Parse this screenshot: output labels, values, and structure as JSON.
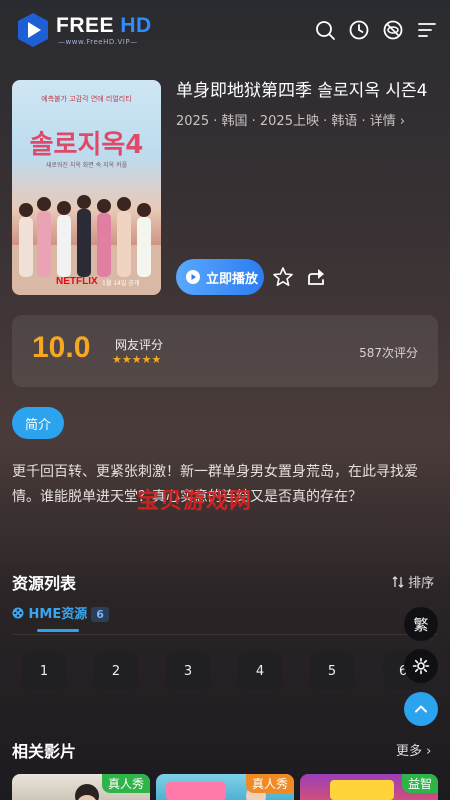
{
  "header": {
    "logo_main": "FREE ",
    "logo_hd": "HD",
    "logo_sub": "—www.FreeHD.VIP—",
    "icons": [
      "search-icon",
      "history-icon",
      "no-ads-icon",
      "menu-icon"
    ]
  },
  "poster": {
    "top_text": "예측불가 고감각 연애 리얼리티",
    "title_text": "솔로지옥4",
    "sub_text": "새로워진 지옥 화면 속 지옥 커플",
    "brand": "NETFLIX",
    "date_text": "1월 14일 공개"
  },
  "movie": {
    "title": "单身即地狱第四季 솔로지옥 시즌4",
    "meta": "2025 · 韩国 · 2025上映 · 韩语 · 详情 ›"
  },
  "actions": {
    "play_label": "立即播放",
    "fav_icon": "star-icon",
    "share_icon": "share-icon"
  },
  "rating": {
    "score": "10.0",
    "label": "网友评分",
    "stars": "★★★★★",
    "count": "587次评分"
  },
  "intro": {
    "tab_label": "简介",
    "description": "更千回百转、更紧张刺激！新一群单身男女置身荒岛，在此寻找爱情。谁能脱单进天堂？真心实意的连结又是否真的存在？",
    "watermark": "宝贝游戏网"
  },
  "resources": {
    "title": "资源列表",
    "sort_label": "排序",
    "source_tab": "HME资源",
    "source_count": "6",
    "episodes": [
      "1",
      "2",
      "3",
      "4",
      "5",
      "6"
    ]
  },
  "floating": {
    "trad_label": "繁"
  },
  "related": {
    "title": "相关影片",
    "more_label": "更多 ›",
    "cards": [
      {
        "tag": "真人秀",
        "tag_color": "#2fb44a"
      },
      {
        "tag": "真人秀",
        "tag_color": "#f08a24"
      },
      {
        "tag": "益智",
        "tag_color": "#2fb44a"
      }
    ]
  },
  "colors": {
    "accent": "#2ba3ee",
    "score": "#f7a823",
    "watermark": "#e02020"
  }
}
